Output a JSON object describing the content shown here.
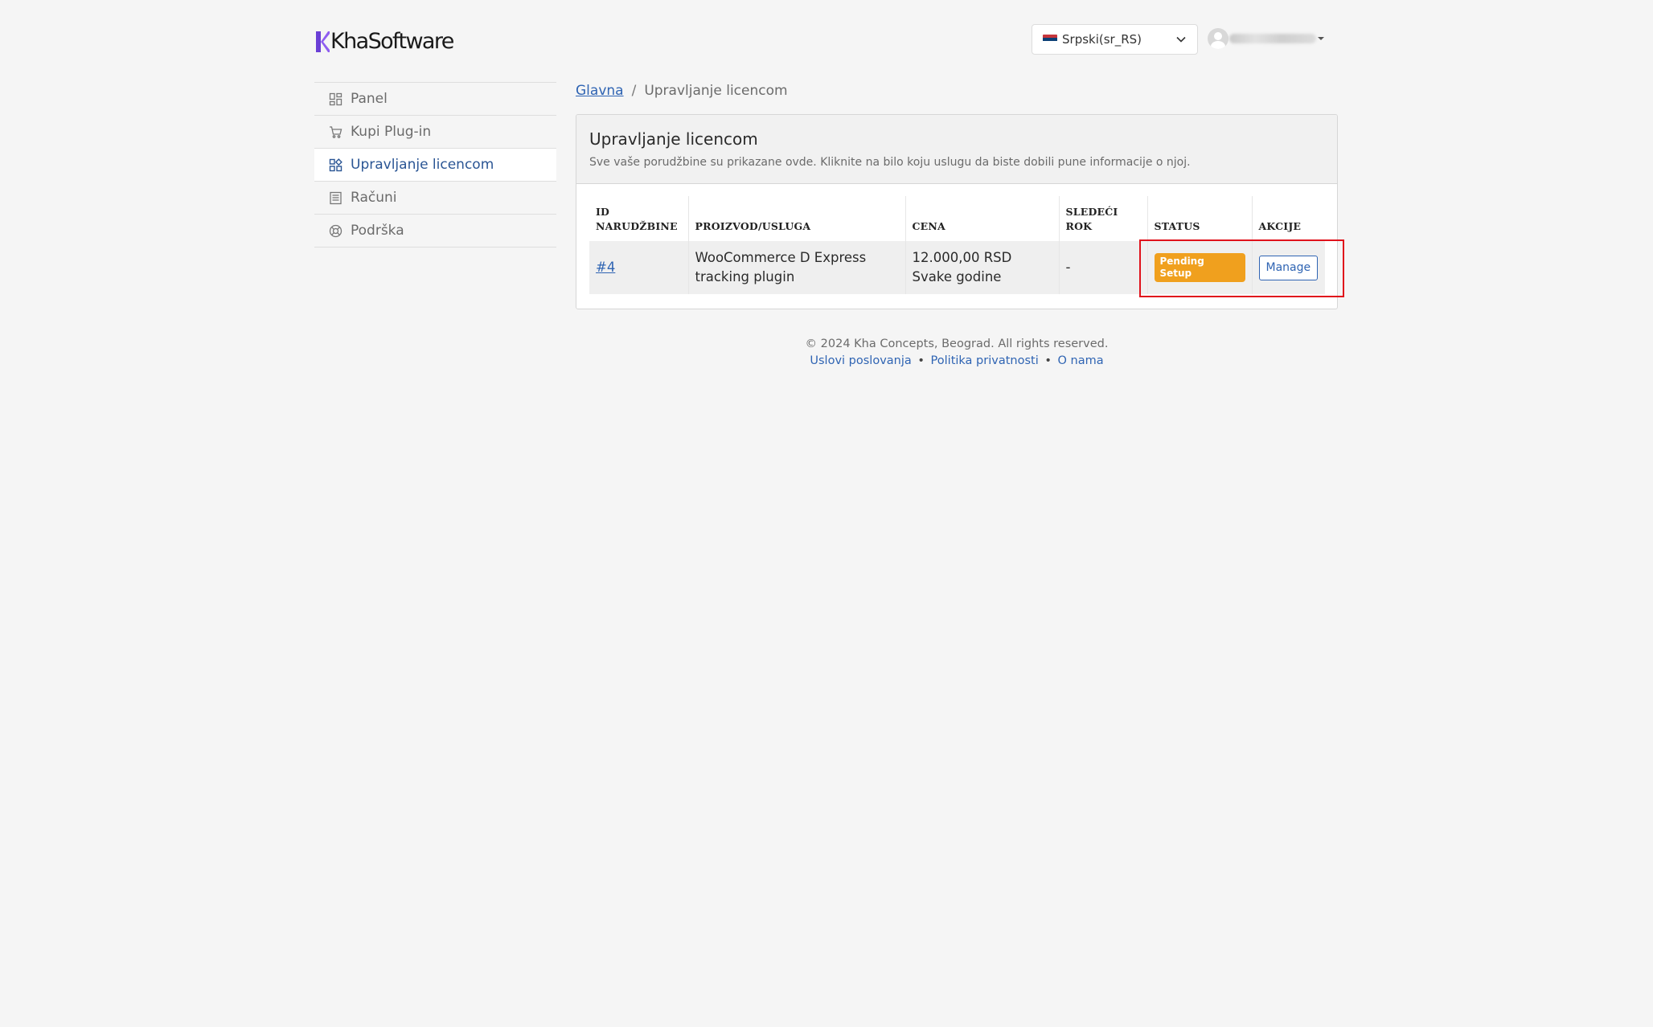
{
  "header": {
    "logo_text": "KhaSoftware",
    "language": "Srpski(sr_RS)",
    "language_flag_icon": "serbia-flag-icon",
    "user_icon": "user-avatar-icon"
  },
  "sidebar": {
    "items": [
      {
        "label": "Panel",
        "icon": "dashboard-icon"
      },
      {
        "label": "Kupi Plug-in",
        "icon": "cart-icon"
      },
      {
        "label": "Upravljanje licencom",
        "icon": "apps-icon",
        "active": true
      },
      {
        "label": "Računi",
        "icon": "invoice-icon"
      },
      {
        "label": "Podrška",
        "icon": "support-icon"
      }
    ]
  },
  "breadcrumb": {
    "home": "Glavna",
    "separator": "/",
    "current": "Upravljanje licencom"
  },
  "card": {
    "title": "Upravljanje licencom",
    "subtitle": "Sve vaše porudžbine su prikazane ovde. Kliknite na bilo koju uslugu da biste dobili pune informacije o njoj."
  },
  "table": {
    "headers": {
      "id_line1": "ID",
      "id_line2": "NARUDŽBINE",
      "product": "PROIZVOD/USLUGA",
      "price": "CENA",
      "next_due": "SLEDEĆI ROK",
      "status": "STATUS",
      "actions": "AKCIJE"
    },
    "rows": [
      {
        "id": "#4",
        "product_line1": "WooCommerce D Express",
        "product_line2": "tracking plugin",
        "price_line1": "12.000,00 RSD",
        "price_line2": "Svake godine",
        "next_due": "-",
        "status": "Pending Setup",
        "action": "Manage"
      }
    ]
  },
  "footer": {
    "copyright": "© 2024 Kha Concepts, Beograd. All rights reserved.",
    "links": [
      "Uslovi poslovanja",
      "Politika privatnosti",
      "O nama"
    ],
    "separator": "•"
  },
  "colors": {
    "accent": "#2f64b3",
    "badge_pending": "#f0a01e",
    "highlight": "#e0121b",
    "logo_mark": "#6a3fd6"
  }
}
